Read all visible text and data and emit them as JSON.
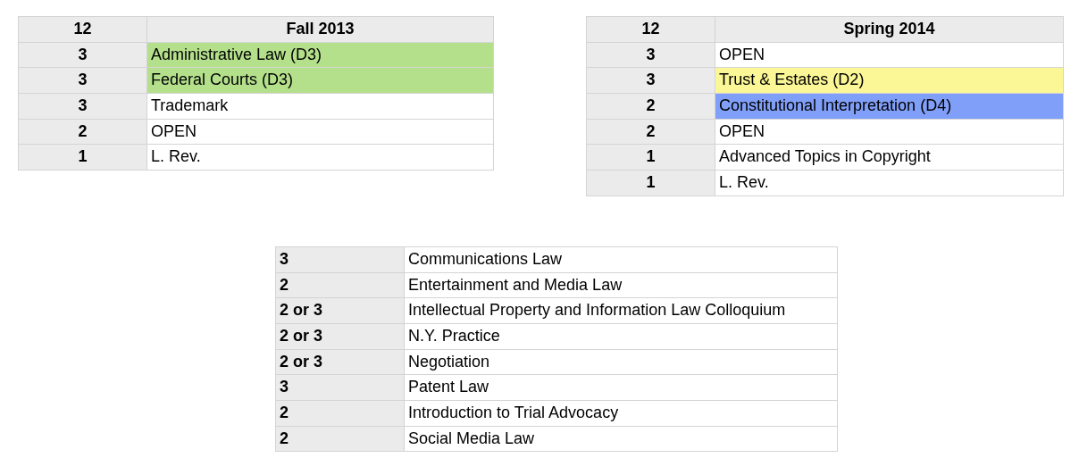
{
  "fall_table": {
    "header": {
      "credits": "12",
      "term": "Fall 2013"
    },
    "rows": [
      {
        "credits": "3",
        "course": "Administrative Law (D3)",
        "color": "#b4e08c"
      },
      {
        "credits": "3",
        "course": "Federal Courts (D3)",
        "color": "#b4e08c"
      },
      {
        "credits": "3",
        "course": "Trademark"
      },
      {
        "credits": "2",
        "course": "OPEN"
      },
      {
        "credits": "1",
        "course": "L. Rev."
      }
    ]
  },
  "spring_table": {
    "header": {
      "credits": "12",
      "term": "Spring 2014"
    },
    "rows": [
      {
        "credits": "3",
        "course": "OPEN"
      },
      {
        "credits": "3",
        "course": "Trust & Estates (D2)",
        "color": "#fbf796"
      },
      {
        "credits": "2",
        "course": "Constitutional Interpretation (D4)",
        "color": "#809ff8"
      },
      {
        "credits": "2",
        "course": "OPEN"
      },
      {
        "credits": "1",
        "course": "Advanced Topics in Copyright"
      },
      {
        "credits": "1",
        "course": "L. Rev."
      }
    ]
  },
  "electives_table": {
    "rows": [
      {
        "credits": "3",
        "course": "Communications Law"
      },
      {
        "credits": "2",
        "course": "Entertainment and Media Law"
      },
      {
        "credits": "2 or 3",
        "course": "Intellectual Property and Information Law Colloquium"
      },
      {
        "credits": "2 or 3",
        "course": "N.Y. Practice"
      },
      {
        "credits": "2 or 3",
        "course": "Negotiation"
      },
      {
        "credits": "3",
        "course": "Patent Law"
      },
      {
        "credits": "2",
        "course": "Introduction to Trial Advocacy"
      },
      {
        "credits": "2",
        "course": "Social Media Law"
      }
    ]
  }
}
